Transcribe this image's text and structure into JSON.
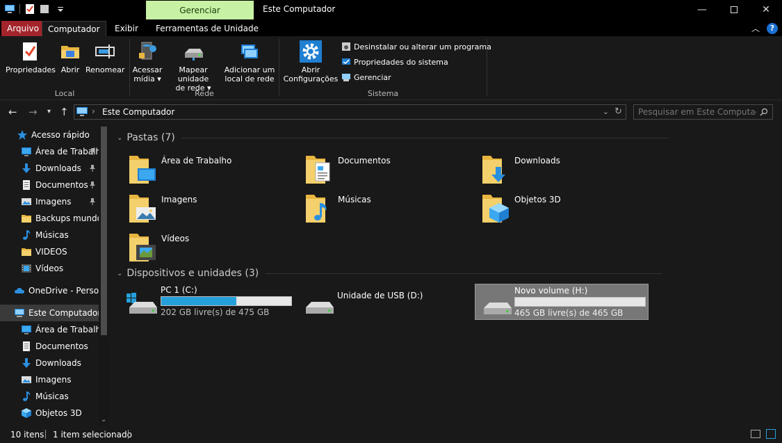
{
  "titlebar": {
    "contextual_tab": "Gerenciar",
    "window_title": "Este Computador"
  },
  "ribbon_tabs": [
    {
      "label": "Arquivo"
    },
    {
      "label": "Computador"
    },
    {
      "label": "Exibir"
    },
    {
      "label": "Ferramentas de Unidade"
    }
  ],
  "ribbon": {
    "local": {
      "group": "Local",
      "buttons": [
        "Propriedades",
        "Abrir",
        "Renomear"
      ]
    },
    "rede": {
      "group": "Rede",
      "acessar": [
        "Acessar",
        "mídia ▾"
      ],
      "mapear": [
        "Mapear unidade",
        "de rede ▾"
      ],
      "adicionar": [
        "Adicionar um",
        "local de rede"
      ]
    },
    "sistema": {
      "group": "Sistema",
      "abrir_config": [
        "Abrir",
        "Configurações"
      ],
      "small": [
        "Desinstalar ou alterar um programa",
        "Propriedades do sistema",
        "Gerenciar"
      ]
    },
    "help": "?"
  },
  "address": {
    "path": "Este Computador",
    "search_placeholder": "Pesquisar em Este Computador"
  },
  "nav": [
    {
      "label": "Acesso rápido",
      "icon": "star-icon",
      "pin": false
    },
    {
      "label": "Área de Trabalho",
      "icon": "desktop-icon",
      "pin": true
    },
    {
      "label": "Downloads",
      "icon": "download-arrow-icon",
      "pin": true
    },
    {
      "label": "Documentos",
      "icon": "document-icon",
      "pin": true
    },
    {
      "label": "Imagens",
      "icon": "image-icon",
      "pin": true
    },
    {
      "label": "Backups mundo",
      "icon": "folder-icon",
      "pin": false
    },
    {
      "label": "Músicas",
      "icon": "music-note-icon",
      "pin": false
    },
    {
      "label": "VIDEOS",
      "icon": "folder-icon",
      "pin": false
    },
    {
      "label": "Vídeos",
      "icon": "film-icon",
      "pin": false
    },
    {
      "label": "OneDrive - Persor",
      "icon": "cloud-icon",
      "pin": false
    },
    {
      "label": "Este Computador",
      "icon": "computer-icon",
      "pin": false
    },
    {
      "label": "Área de Trabalho",
      "icon": "desktop-icon",
      "pin": false
    },
    {
      "label": "Documentos",
      "icon": "document-icon",
      "pin": false
    },
    {
      "label": "Downloads",
      "icon": "download-arrow-icon",
      "pin": false
    },
    {
      "label": "Imagens",
      "icon": "image-icon",
      "pin": false
    },
    {
      "label": "Músicas",
      "icon": "music-note-icon",
      "pin": false
    },
    {
      "label": "Objetos 3D",
      "icon": "cube-icon",
      "pin": false
    }
  ],
  "folders_section": "Pastas (7)",
  "folders": [
    {
      "name": "Área de Trabalho",
      "overlay": "desktop"
    },
    {
      "name": "Documentos",
      "overlay": "document"
    },
    {
      "name": "Downloads",
      "overlay": "download"
    },
    {
      "name": "Imagens",
      "overlay": "image"
    },
    {
      "name": "Músicas",
      "overlay": "music"
    },
    {
      "name": "Objetos 3D",
      "overlay": "cube"
    },
    {
      "name": "Vídeos",
      "overlay": "film"
    }
  ],
  "drives_section": "Dispositivos e unidades (3)",
  "drives": [
    {
      "name": "PC 1 (C:)",
      "free": "202 GB livre(s) de 475 GB",
      "used_fraction": 0.575,
      "windows_logo": true
    },
    {
      "name": "Unidade de USB (D:)"
    },
    {
      "name": "Novo volume (H:)",
      "free": "465 GB livre(s) de 465 GB",
      "used_fraction": 0.0
    }
  ],
  "status": {
    "count": "10 itens",
    "selected": "1 item selecionado"
  },
  "colors": {
    "accent_file_tab": "#a3242b",
    "manage_tab": "#c7f2a4",
    "drive_bar_fill": "#26a0da",
    "background": "#191919"
  }
}
